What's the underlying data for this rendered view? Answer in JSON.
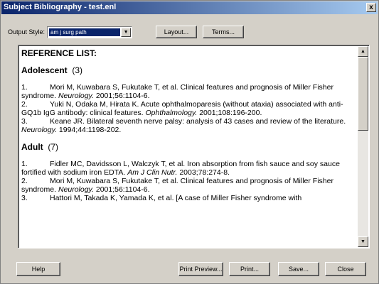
{
  "window": {
    "title": "Subject Bibliography - test.enl",
    "close_glyph": "x"
  },
  "style_bar": {
    "label": "Output Style:",
    "selected": "am j surg path",
    "arrow_glyph": "▼",
    "layout_label": "Layout...",
    "terms_label": "Terms..."
  },
  "document": {
    "heading": "REFERENCE LIST:",
    "sections": [
      {
        "name": "Adolescent",
        "count": "(3)",
        "refs": [
          {
            "num": "1.",
            "text_before": "Mori M, Kuwabara S, Fukutake T, et al. Clinical features and prognosis of Miller Fisher syndrome. ",
            "journal": "Neurology.",
            "text_after": " 2001;56:1104-6."
          },
          {
            "num": "2.",
            "text_before": "Yuki N, Odaka M, Hirata K. Acute ophthalmoparesis (without ataxia) associated with anti-GQ1b IgG antibody: clinical features. ",
            "journal": "Ophthalmology.",
            "text_after": " 2001;108:196-200."
          },
          {
            "num": "3.",
            "text_before": "Keane JR. Bilateral seventh nerve palsy: analysis of 43 cases and review of the literature. ",
            "journal": "Neurology.",
            "text_after": " 1994;44:1198-202."
          }
        ]
      },
      {
        "name": "Adult",
        "count": "(7)",
        "refs": [
          {
            "num": "1.",
            "text_before": "Fidler MC, Davidsson L, Walczyk T, et al. Iron absorption from fish sauce and soy sauce fortified with sodium iron EDTA. ",
            "journal": "Am J Clin Nutr.",
            "text_after": " 2003;78:274-8."
          },
          {
            "num": "2.",
            "text_before": "Mori M, Kuwabara S, Fukutake T, et al. Clinical features and prognosis of Miller Fisher syndrome. ",
            "journal": "Neurology.",
            "text_after": " 2001;56:1104-6."
          },
          {
            "num": "3.",
            "text_before": "Hattori M, Takada K, Yamada K, et al. [A case of Miller Fisher syndrome with",
            "journal": "",
            "text_after": ""
          }
        ]
      }
    ],
    "scroll_up_glyph": "▲",
    "scroll_down_glyph": "▼"
  },
  "buttons": {
    "help": "Help",
    "print_preview": "Print Preview...",
    "print": "Print...",
    "save": "Save...",
    "close": "Close"
  }
}
